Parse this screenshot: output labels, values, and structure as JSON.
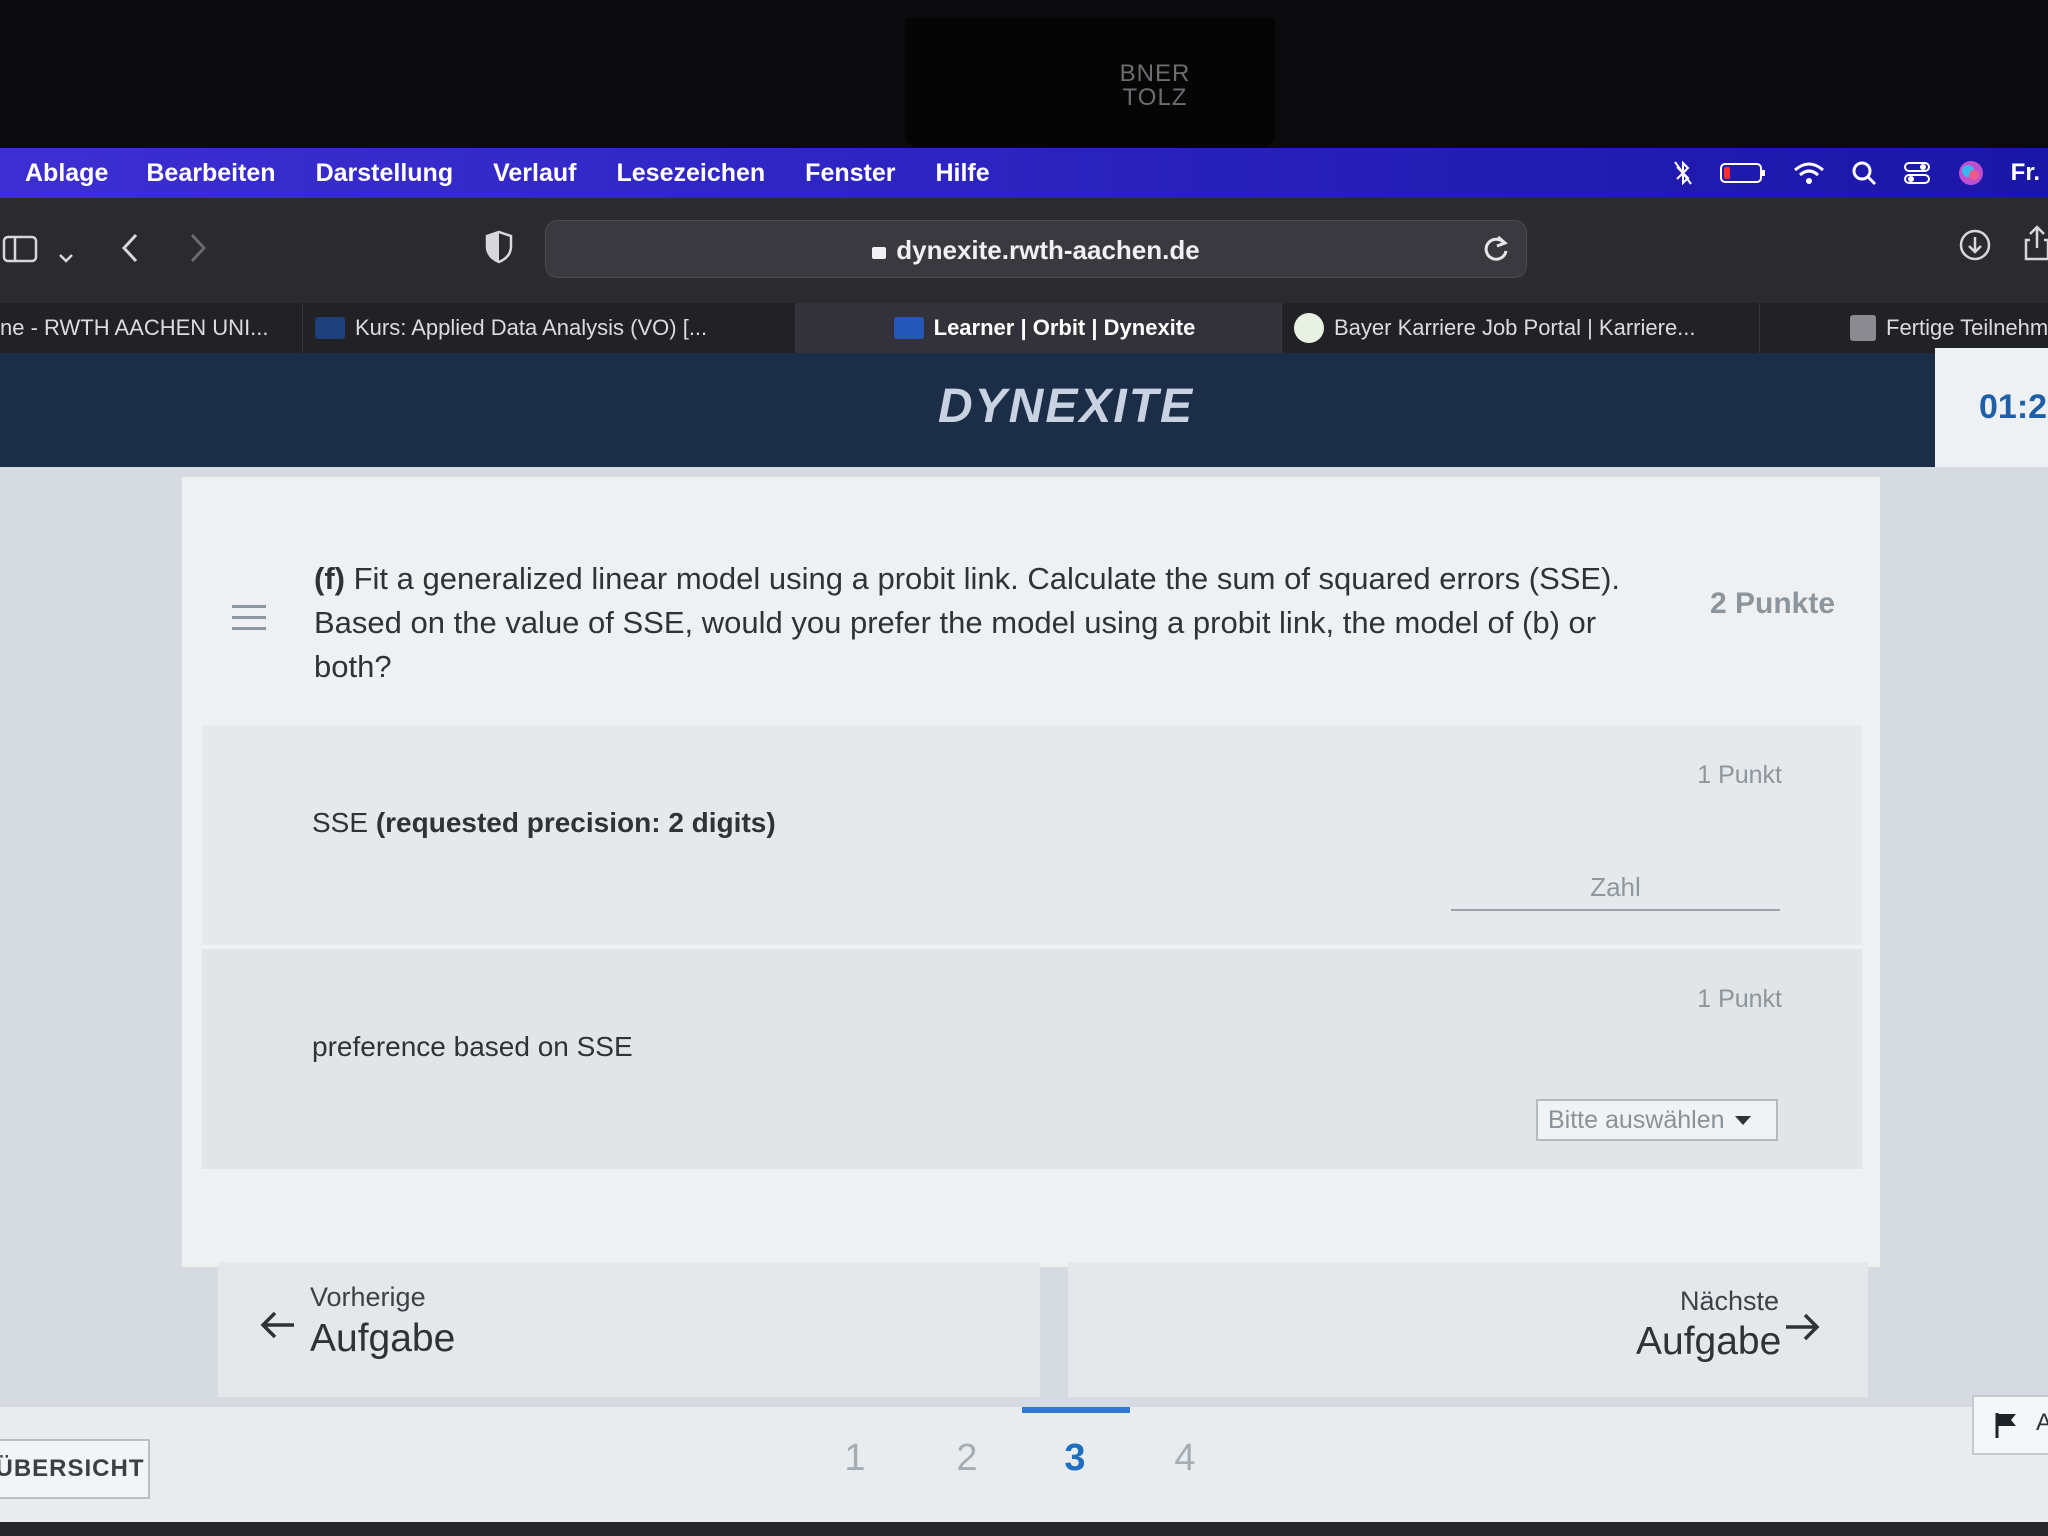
{
  "bezel": {
    "camera_label": "BNER\nTOLZ"
  },
  "menubar": {
    "items": [
      "Ablage",
      "Bearbeiten",
      "Darstellung",
      "Verlauf",
      "Lesezeichen",
      "Fenster",
      "Hilfe"
    ],
    "clock": "Fr."
  },
  "toolbar": {
    "url": "dynexite.rwth-aachen.de"
  },
  "tabs": [
    {
      "label": "ne - RWTH AACHEN UNI...",
      "active": false
    },
    {
      "label": "Kurs: Applied Data Analysis (VO) [...",
      "active": false
    },
    {
      "label": "Learner | Orbit | Dynexite",
      "active": true
    },
    {
      "label": "Bayer Karriere Job Portal | Karriere...",
      "active": false
    },
    {
      "label": "Fertige Teilnehme",
      "active": false
    }
  ],
  "header": {
    "logo": "DYNEXITE",
    "timer": "01:2"
  },
  "question": {
    "label": "(f)",
    "text": " Fit a generalized linear model using a probit link. Calculate the sum of squared errors (SSE). Based on the value of SSE, would you prefer the model using a probit link, the model of (b) or both?",
    "points": "2 Punkte"
  },
  "subquestions": [
    {
      "points": "1 Punkt",
      "label": "SSE",
      "label_bold": "(requested precision: 2 digits)",
      "input_placeholder": "Zahl"
    },
    {
      "points": "1 Punkt",
      "label": "preference based on SSE",
      "select_value": "Bitte auswählen"
    }
  ],
  "navigation": {
    "prev_small": "Vorherige",
    "prev_big": "Aufgabe",
    "next_small": "Nächste",
    "next_big": "Aufgabe"
  },
  "bottom": {
    "overview": "ÜBERSICHT",
    "pages": [
      "1",
      "2",
      "3",
      "4"
    ],
    "current_page": "3",
    "flag_label": "A"
  },
  "colors": {
    "accent": "#2f7ad1",
    "header": "#1c2d48",
    "menubar": "#2f25c4"
  }
}
